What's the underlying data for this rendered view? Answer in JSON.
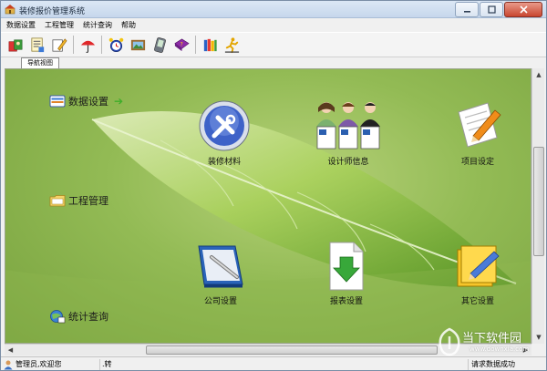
{
  "window": {
    "title": "装修报价管理系统",
    "app_icon": "app-logo-icon",
    "minimize_icon": "minimize-icon",
    "maximize_icon": "maximize-icon",
    "close_icon": "close-icon"
  },
  "menu": {
    "items": [
      "数据设置",
      "工程管理",
      "统计查询",
      "帮助"
    ]
  },
  "toolbar": {
    "icons": [
      "users-icon",
      "document-icon",
      "edit-icon",
      "umbrella-icon",
      "alarm-clock-icon",
      "picture-icon",
      "pda-icon",
      "help-book-icon",
      "books-icon",
      "exit-runner-icon"
    ]
  },
  "tabs": {
    "active_label": "导航视图"
  },
  "nav": {
    "data_settings": "数据设置",
    "project_management": "工程管理",
    "statistics_query": "统计查询"
  },
  "tiles": {
    "materials": "装修材料",
    "designers": "设计师信息",
    "project_settings": "项目设定",
    "company_settings": "公司设置",
    "report_settings": "报表设置",
    "other_settings": "其它设置"
  },
  "status": {
    "user_text": "管理员,欢迎您",
    "middle_text": ".转",
    "right_text": "请求数据成功"
  },
  "watermark": {
    "cn": "当下软件园",
    "en": "www.downxia.com"
  },
  "colors": {
    "content_green": "#93bb55",
    "leaf_highlight": "#c4df8a",
    "accent_arrow": "#3fae2a"
  }
}
